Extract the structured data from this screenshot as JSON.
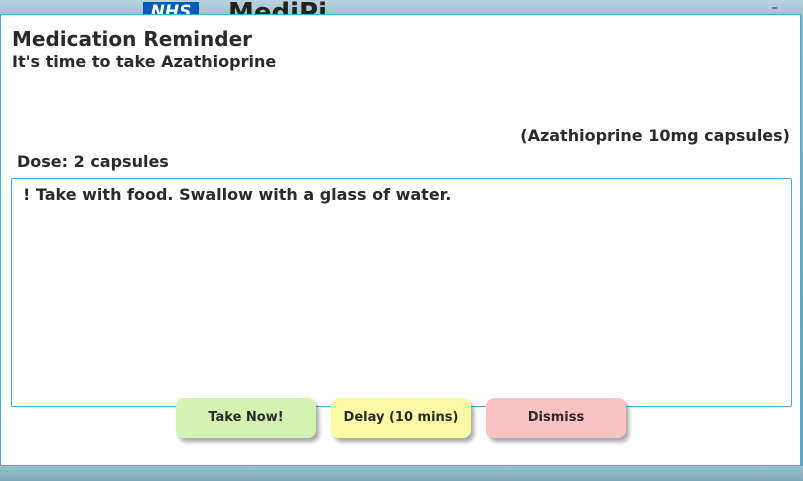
{
  "background_window": {
    "logo_text": "NHS",
    "app_title": "MediPi",
    "minimize_glyph": "–"
  },
  "dialog": {
    "title": "Medication Reminder",
    "subtitle": "It's time to take Azathioprine",
    "medication_description": "(Azathioprine 10mg capsules)",
    "dose": "Dose: 2 capsules",
    "instructions": "! Take with food. Swallow with a glass of water."
  },
  "buttons": {
    "take_now": "Take Now!",
    "delay": "Delay (10 mins)",
    "dismiss": "Dismiss"
  },
  "colors": {
    "accent_border": "#39b4d6",
    "take_now_bg": "#d3f3b3",
    "delay_bg": "#fafaa6",
    "dismiss_bg": "#fbc2c4",
    "nhs_blue": "#005eb8"
  }
}
